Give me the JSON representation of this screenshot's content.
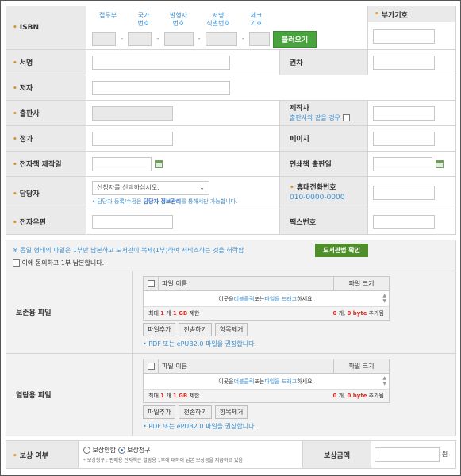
{
  "isbn": {
    "label": "ISBN",
    "seg_labels": [
      "접두부",
      "국가\n번호",
      "발행자\n번호",
      "서명\n식별번호",
      "체크\n기호"
    ],
    "fetch_button": "불러오기",
    "addon_label": "부가기호"
  },
  "fields": {
    "title": "서명",
    "volume": "권차",
    "author": "저자",
    "publisher": "출판사",
    "producer": "제작사",
    "producer_same": "출판사와 같을 경우",
    "price": "정가",
    "pages": "페이지",
    "ebook_date": "전자책 제작일",
    "print_date": "인쇄책 출판일",
    "manager": "담당자",
    "manager_select": "신청자를 선택하십시오.",
    "manager_hint_prefix": "• 담당자 등록/수정은 ",
    "manager_hint_link": "담당자 정보관리",
    "manager_hint_suffix": "를 통해서만 가능합니다.",
    "mobile": "휴대전화번호",
    "mobile_placeholder": "010-0000-0000",
    "postcode": "전자우편",
    "fax": "팩스번호"
  },
  "notice": {
    "text": "※ 동일 형태의 파일은 1부만 납본하고 도서관이 복제(1부)하여 서비스하는 것을 허락함",
    "button": "도서관법 확인",
    "agree": "이에 동의하고 1부 납본합니다."
  },
  "files": [
    {
      "label": "보존용 파일",
      "col_name": "파일 이름",
      "col_size": "파일 크기",
      "drop_pre": "이곳을 ",
      "drop_a": "더블클릭",
      "drop_mid": " 또는 ",
      "drop_b": "파일을 드래그",
      "drop_post": " 하세요.",
      "limit_pre": "최대 ",
      "limit_count": "1",
      "limit_mid": " 개 ",
      "limit_size": "1 GB",
      "limit_post": " 제한",
      "added_count": "0",
      "added_mid": " 개, ",
      "added_size": "0 byte",
      "added_post": " 추가됨",
      "btn_add": "파일추가",
      "btn_send": "전송하기",
      "btn_remove": "항목제거",
      "hint": "• PDF 또는 ePUB2.0 파일을 권장합니다."
    },
    {
      "label": "열람용 파일",
      "col_name": "파일 이름",
      "col_size": "파일 크기",
      "drop_pre": "이곳을 ",
      "drop_a": "더블클릭",
      "drop_mid": " 또는 ",
      "drop_b": "파일을 드래그",
      "drop_post": " 하세요.",
      "limit_pre": "최대 ",
      "limit_count": "1",
      "limit_mid": " 개 ",
      "limit_size": "1 GB",
      "limit_post": " 제한",
      "added_count": "0",
      "added_mid": " 개, ",
      "added_size": "0 byte",
      "added_post": " 추가됨",
      "btn_add": "파일추가",
      "btn_send": "전송하기",
      "btn_remove": "항목제거",
      "hint": "• PDF 또는 ePUB2.0 파일을 권장합니다."
    }
  ],
  "compensation": {
    "label": "보상 여부",
    "opt_no": "보상안함",
    "opt_yes": "보상청구",
    "selected": "보상청구",
    "note": "* 보상청구 : 판매용 전자책은 열람용 1부에 대하여 납본 보상금을 지급하고 있음",
    "amount_label": "보상금액",
    "unit": "원"
  }
}
